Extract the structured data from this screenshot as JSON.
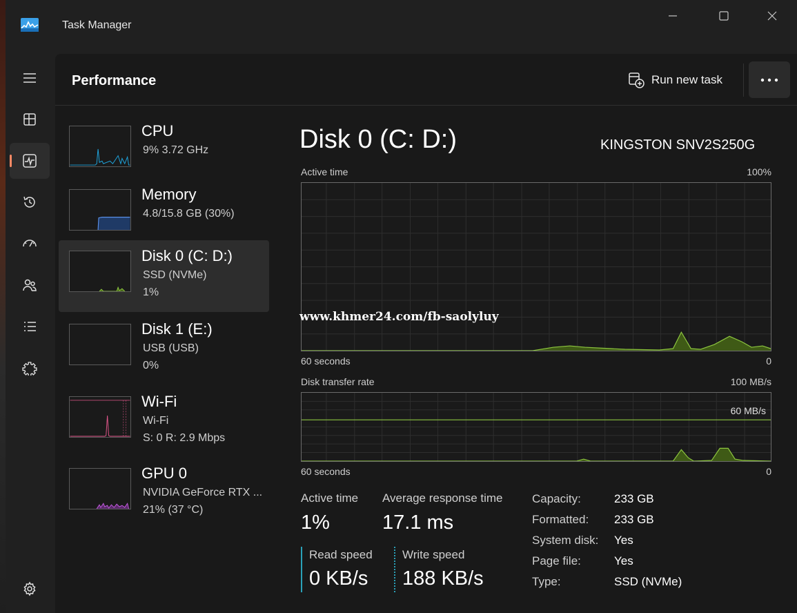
{
  "window": {
    "title": "Task Manager"
  },
  "header": {
    "page_title": "Performance",
    "run_task_label": "Run new task"
  },
  "nav": [
    {
      "id": "menu",
      "icon": "hamburger-icon"
    },
    {
      "id": "processes",
      "icon": "processes-icon"
    },
    {
      "id": "performance",
      "icon": "performance-icon",
      "active": true
    },
    {
      "id": "app-history",
      "icon": "history-icon"
    },
    {
      "id": "startup-apps",
      "icon": "startup-icon"
    },
    {
      "id": "users",
      "icon": "users-icon"
    },
    {
      "id": "details",
      "icon": "details-icon"
    },
    {
      "id": "services",
      "icon": "services-icon"
    },
    {
      "id": "settings",
      "icon": "settings-icon"
    }
  ],
  "devices": [
    {
      "name": "CPU",
      "line1": "9%  3.72 GHz",
      "line2": "",
      "color": "#1ea6e0"
    },
    {
      "name": "Memory",
      "line1": "4.8/15.8 GB (30%)",
      "line2": "",
      "color": "#5a8fe6"
    },
    {
      "name": "Disk 0 (C: D:)",
      "line1": "SSD (NVMe)",
      "line2": "1%",
      "color": "#8dc63f",
      "selected": true
    },
    {
      "name": "Disk 1 (E:)",
      "line1": "USB (USB)",
      "line2": "0%",
      "color": "#8dc63f"
    },
    {
      "name": "Wi-Fi",
      "line1": "Wi-Fi",
      "line2": "S: 0  R: 2.9 Mbps",
      "color": "#e0568a"
    },
    {
      "name": "GPU 0",
      "line1": "NVIDIA GeForce RTX ...",
      "line2": "21%  (37 °C)",
      "color": "#c45be0"
    }
  ],
  "detail": {
    "title": "Disk 0 (C: D:)",
    "model": "KINGSTON SNV2S250G",
    "active_graph": {
      "label": "Active time",
      "max_label": "100%",
      "time_label": "60 seconds",
      "min_label": "0"
    },
    "transfer_graph": {
      "label": "Disk transfer rate",
      "max_label": "100 MB/s",
      "line_label": "60 MB/s",
      "time_label": "60 seconds",
      "min_label": "0"
    },
    "stats": {
      "active_time_label": "Active time",
      "active_time_value": "1%",
      "avg_response_label": "Average response time",
      "avg_response_value": "17.1 ms",
      "read_label": "Read speed",
      "read_value": "0 KB/s",
      "write_label": "Write speed",
      "write_value": "188 KB/s"
    },
    "info": [
      {
        "key": "Capacity:",
        "value": "233 GB"
      },
      {
        "key": "Formatted:",
        "value": "233 GB"
      },
      {
        "key": "System disk:",
        "value": "Yes"
      },
      {
        "key": "Page file:",
        "value": "Yes"
      },
      {
        "key": "Type:",
        "value": "SSD (NVMe)"
      }
    ]
  },
  "watermark": "www.khmer24.com/fb-saolyluy",
  "colors": {
    "accent": "#ff8a65",
    "disk": "#8dc63f",
    "read_bar": "#2aa1b8",
    "write_bar": "#2aa1b8"
  }
}
